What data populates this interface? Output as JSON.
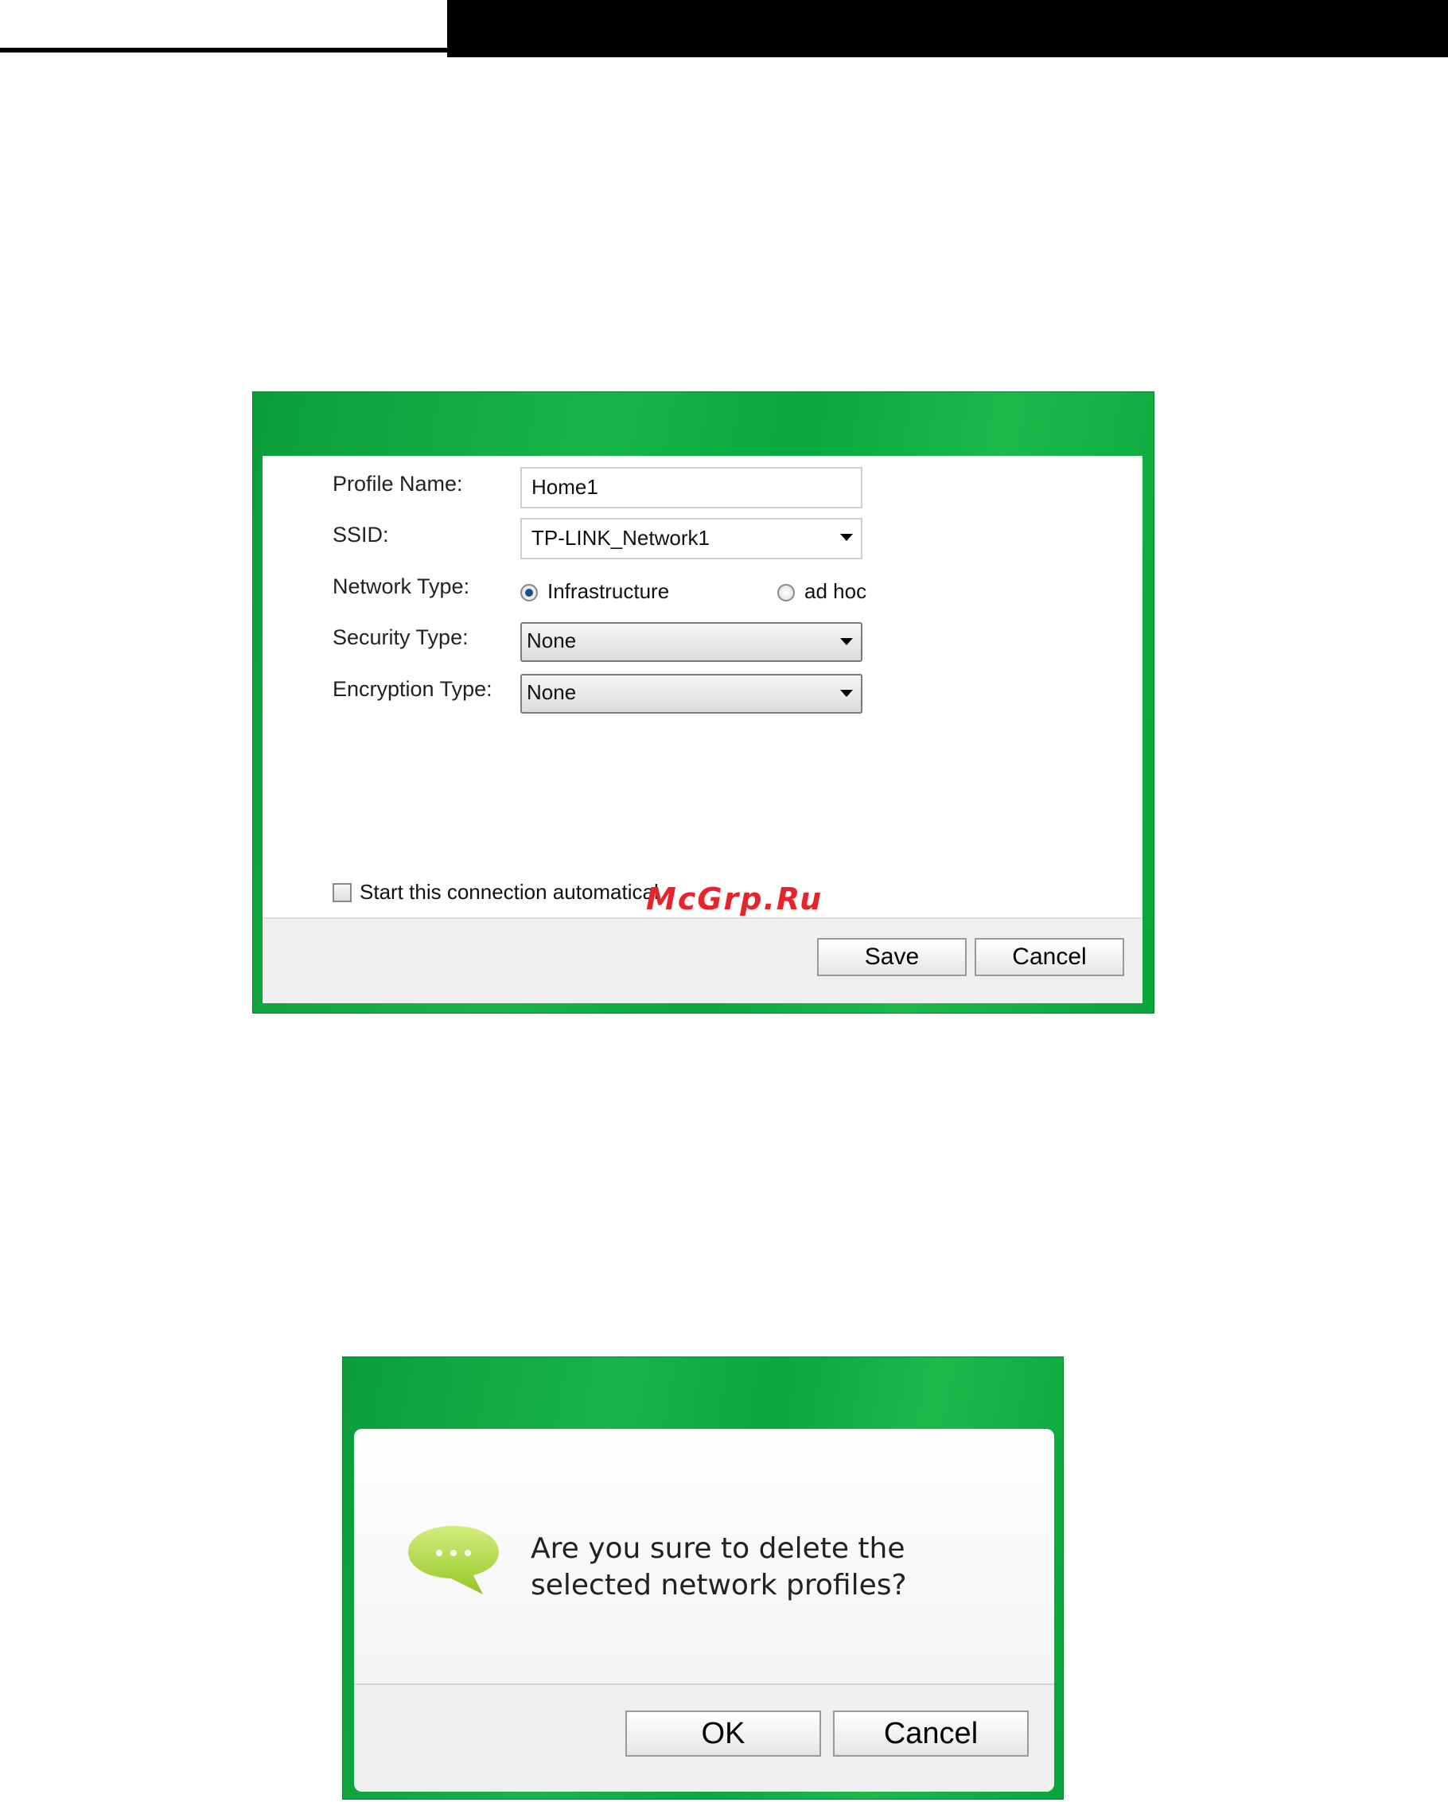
{
  "profile_dialog": {
    "labels": {
      "profile_name": "Profile Name:",
      "ssid": "SSID:",
      "network_type": "Network Type:",
      "security_type": "Security Type:",
      "encryption_type": "Encryption Type:"
    },
    "profile_name_value": "Home1",
    "ssid_value": "TP-LINK_Network1",
    "network_type": {
      "options": [
        "Infrastructure",
        "ad hoc"
      ],
      "selected": "Infrastructure"
    },
    "security_type_value": "None",
    "encryption_type_value": "None",
    "auto_connect_label": "Start this connection automatical",
    "auto_connect_checked": false,
    "buttons": {
      "save": "Save",
      "cancel": "Cancel"
    }
  },
  "watermark": "McGrp.Ru",
  "confirm_dialog": {
    "message": "Are you sure to delete the selected network profiles?",
    "icon": "speech-bubble-icon",
    "buttons": {
      "ok": "OK",
      "cancel": "Cancel"
    }
  },
  "colors": {
    "frame_green": "#18b548",
    "watermark_red": "#e8242b"
  }
}
